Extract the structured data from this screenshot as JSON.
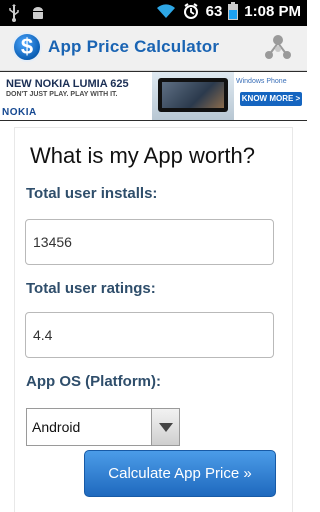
{
  "status_bar": {
    "battery_percent": "63",
    "time": "1:08 PM"
  },
  "app": {
    "title": "App Price Calculator",
    "icon_symbol": "$"
  },
  "ad": {
    "line1": "NEW NOKIA LUMIA 625",
    "line2": "DON'T JUST PLAY. PLAY WITH IT.",
    "brand": "NOKIA",
    "platform_label": "Windows Phone",
    "cta": "KNOW MORE >"
  },
  "main": {
    "heading": "What is my App worth?",
    "installs_label": "Total user installs:",
    "installs_value": "13456",
    "ratings_label": "Total user ratings:",
    "ratings_value": "4.4",
    "os_label": "App OS (Platform):",
    "os_selected": "Android",
    "calculate_button": "Calculate App Price »"
  },
  "colors": {
    "title_blue": "#1a64b3",
    "label_slate": "#2f4e6b",
    "button_blue": "#2f7fd0"
  }
}
